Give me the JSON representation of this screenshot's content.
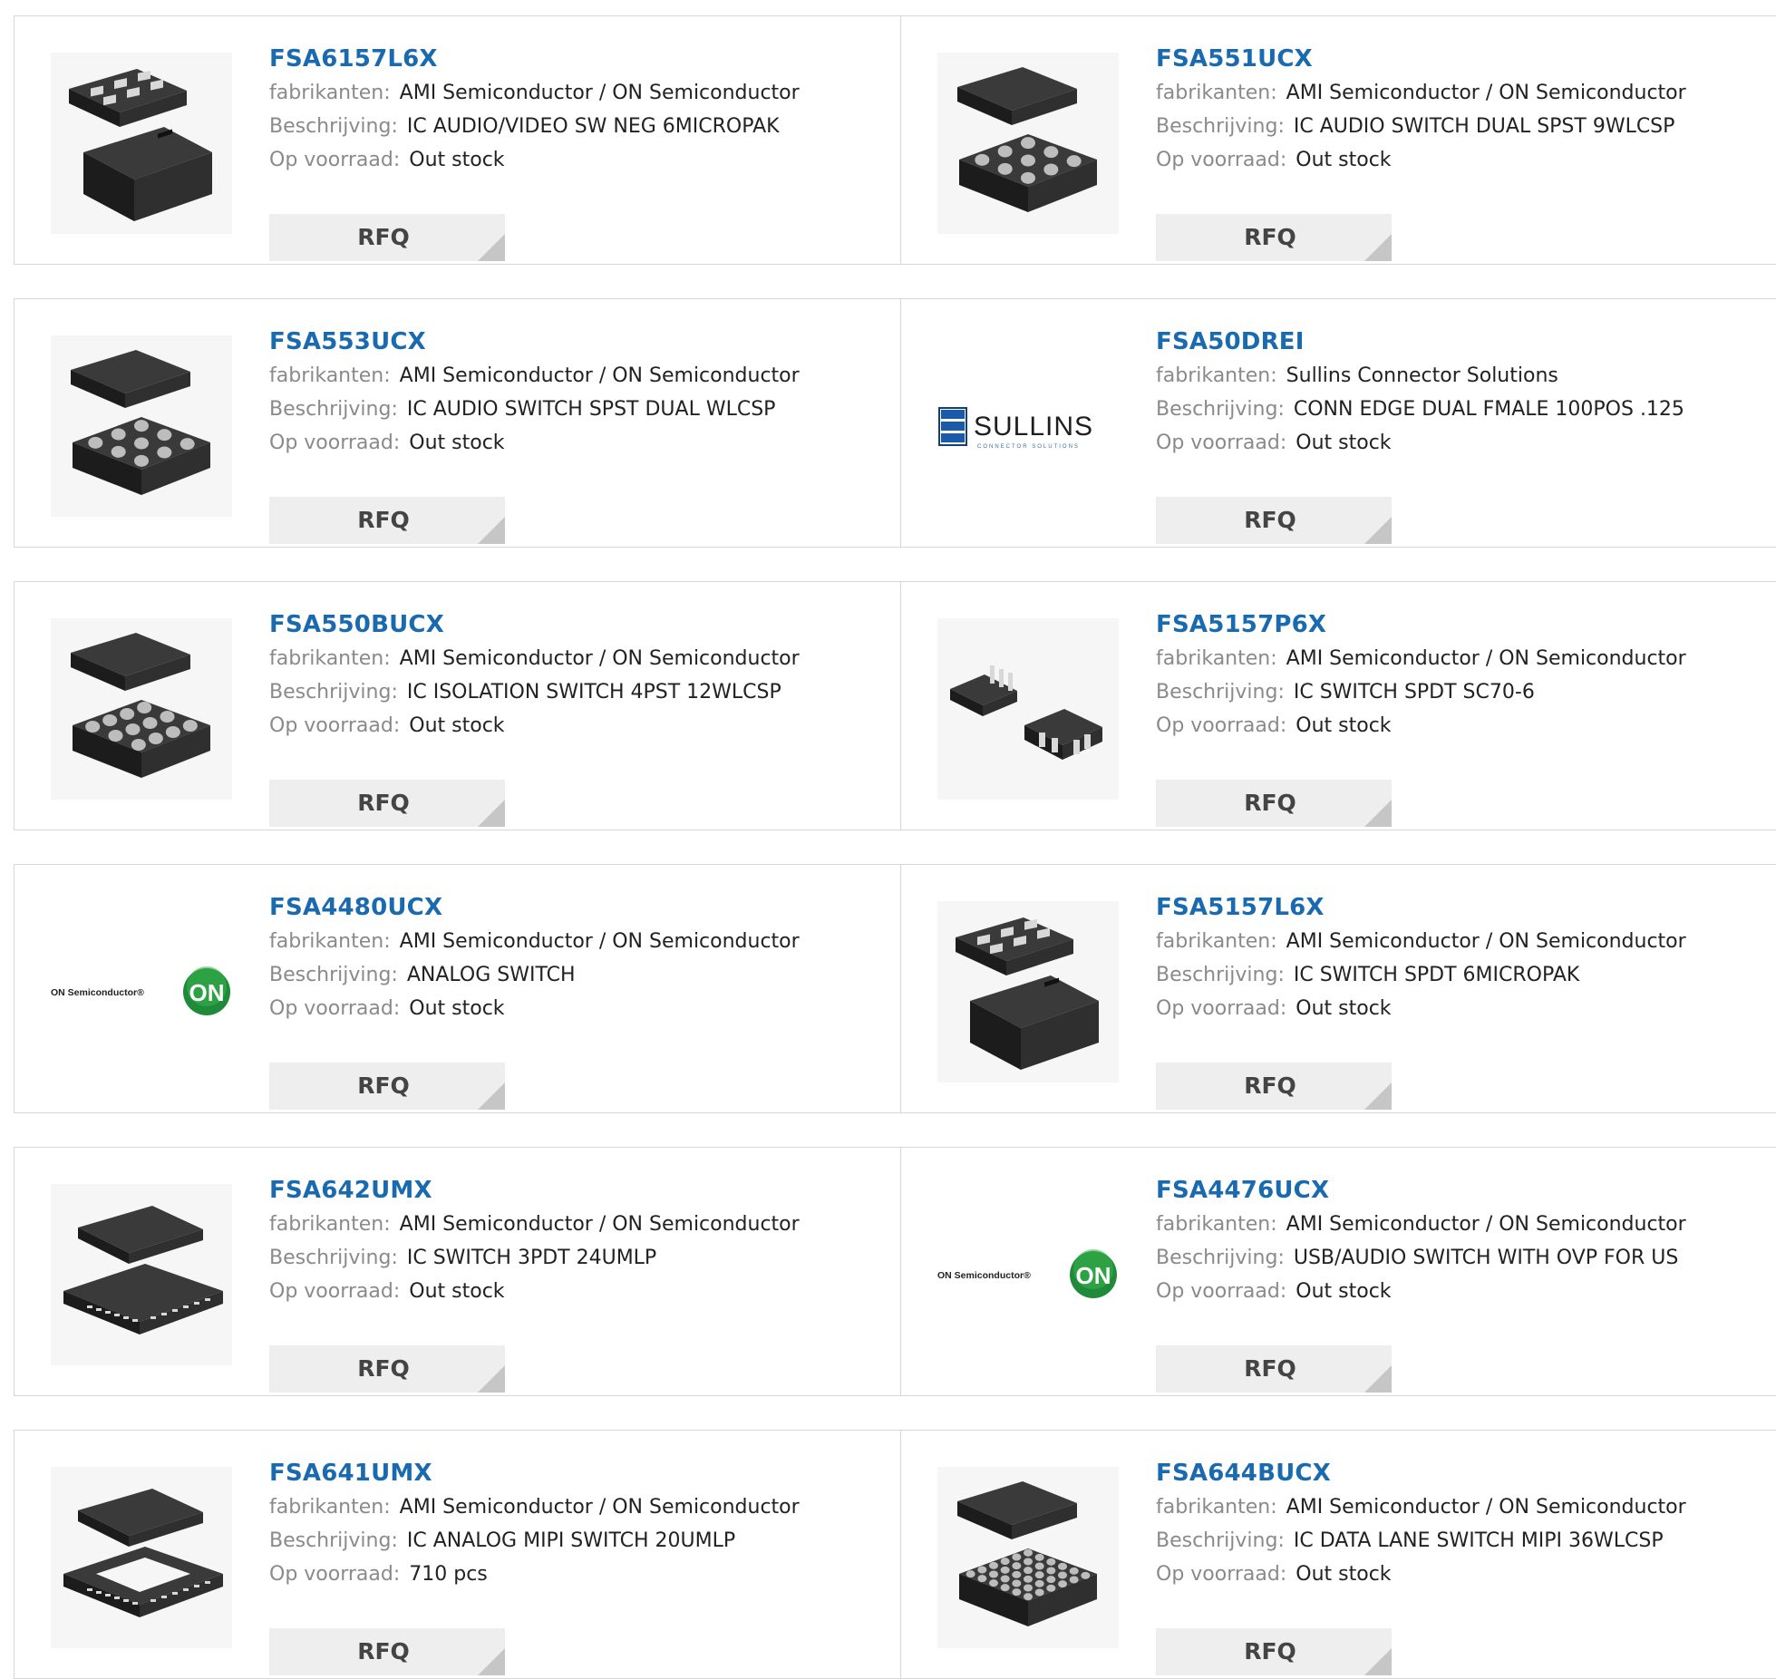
{
  "labels": {
    "manufacturer": "fabrikanten:",
    "description": "Beschrijving:",
    "stock": "Op voorraad:",
    "rfq": "RFQ"
  },
  "colors": {
    "link": "#1a6aaf",
    "label": "#8a8a8a",
    "button_bg": "#eeeeee",
    "border": "#d6d6d6"
  },
  "products": [
    {
      "part": "FSA6157L6X",
      "manufacturer": "AMI Semiconductor / ON Semiconductor",
      "description": "IC AUDIO/VIDEO SW NEG 6MICROPAK",
      "stock": "Out stock",
      "image": "micropak-6-icon"
    },
    {
      "part": "FSA551UCX",
      "manufacturer": "AMI Semiconductor / ON Semiconductor",
      "description": "IC AUDIO SWITCH DUAL SPST 9WLCSP",
      "stock": "Out stock",
      "image": "wlcsp-9-icon"
    },
    {
      "part": "FSA553UCX",
      "manufacturer": "AMI Semiconductor / ON Semiconductor",
      "description": "IC AUDIO SWITCH SPST DUAL WLCSP",
      "stock": "Out stock",
      "image": "wlcsp-9-icon"
    },
    {
      "part": "FSA50DREI",
      "manufacturer": "Sullins Connector Solutions",
      "description": "CONN EDGE DUAL FMALE 100POS .125",
      "stock": "Out stock",
      "image": "sullins-logo",
      "logo_text": "SULLINS",
      "logo_sub": "CONNECTOR SOLUTIONS"
    },
    {
      "part": "FSA550BUCX",
      "manufacturer": "AMI Semiconductor / ON Semiconductor",
      "description": "IC ISOLATION SWITCH 4PST 12WLCSP",
      "stock": "Out stock",
      "image": "wlcsp-12-icon"
    },
    {
      "part": "FSA5157P6X",
      "manufacturer": "AMI Semiconductor / ON Semiconductor",
      "description": "IC SWITCH SPDT SC70-6",
      "stock": "Out stock",
      "image": "sc70-6-icon"
    },
    {
      "part": "FSA4480UCX",
      "manufacturer": "AMI Semiconductor / ON Semiconductor",
      "description": "ANALOG SWITCH",
      "stock": "Out stock",
      "image": "on-semiconductor-logo",
      "logo_text": "ON Semiconductor®",
      "logo_badge": "ON"
    },
    {
      "part": "FSA5157L6X",
      "manufacturer": "AMI Semiconductor / ON Semiconductor",
      "description": "IC SWITCH SPDT 6MICROPAK",
      "stock": "Out stock",
      "image": "micropak-6-icon"
    },
    {
      "part": "FSA642UMX",
      "manufacturer": "AMI Semiconductor / ON Semiconductor",
      "description": "IC SWITCH 3PDT 24UMLP",
      "stock": "Out stock",
      "image": "umlp-24-icon"
    },
    {
      "part": "FSA4476UCX",
      "manufacturer": "AMI Semiconductor / ON Semiconductor",
      "description": "USB/AUDIO SWITCH WITH OVP FOR US",
      "stock": "Out stock",
      "image": "on-semiconductor-logo",
      "logo_text": "ON Semiconductor®",
      "logo_badge": "ON"
    },
    {
      "part": "FSA641UMX",
      "manufacturer": "AMI Semiconductor / ON Semiconductor",
      "description": "IC ANALOG MIPI SWITCH 20UMLP",
      "stock": "710 pcs",
      "image": "umlp-20-icon"
    },
    {
      "part": "FSA644BUCX",
      "manufacturer": "AMI Semiconductor / ON Semiconductor",
      "description": "IC DATA LANE SWITCH MIPI 36WLCSP",
      "stock": "Out stock",
      "image": "wlcsp-36-icon"
    }
  ]
}
